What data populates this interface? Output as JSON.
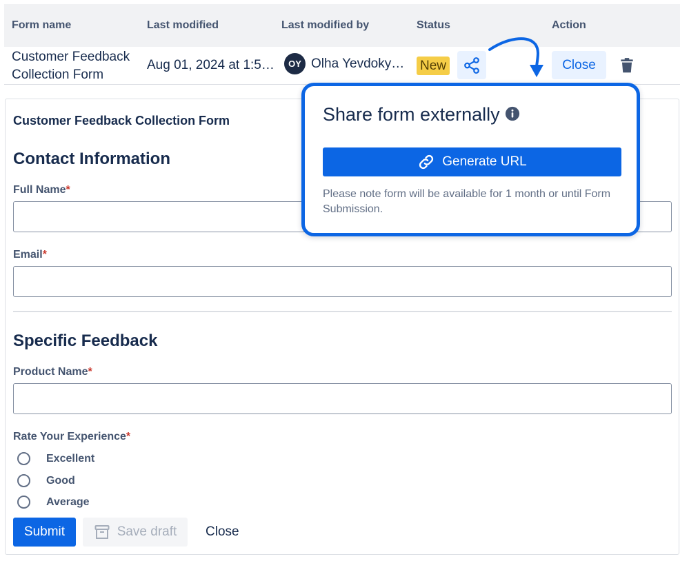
{
  "table": {
    "headers": {
      "form_name": "Form name",
      "last_modified": "Last modified",
      "last_modified_by": "Last modified by",
      "status": "Status",
      "action": "Action"
    },
    "row": {
      "form_name": "Customer Feedback Collection Form",
      "last_modified": "Aug 01, 2024 at 1:5…",
      "avatar_initials": "OY",
      "last_modified_by": "Olha Yevdoky…",
      "status": "New",
      "close_label": "Close",
      "share_icon": "share-icon",
      "delete_icon": "trash-icon"
    }
  },
  "form": {
    "title": "Customer Feedback Collection Form",
    "section1": "Contact Information",
    "full_name_label": "Full Name",
    "email_label": "Email",
    "section2": "Specific Feedback",
    "product_name_label": "Product Name",
    "rate_label": "Rate Your Experience",
    "required_mark": "*",
    "options": [
      "Excellent",
      "Good",
      "Average"
    ],
    "submit_label": "Submit",
    "save_draft_label": "Save draft",
    "close_label": "Close"
  },
  "popup": {
    "title": "Share form externally",
    "generate_label": "Generate URL",
    "note": "Please note form will be available for 1 month or until Form Submission."
  },
  "colors": {
    "primary": "#0c66e4",
    "status_new": "#f5cd47",
    "required": "#c9372c"
  }
}
